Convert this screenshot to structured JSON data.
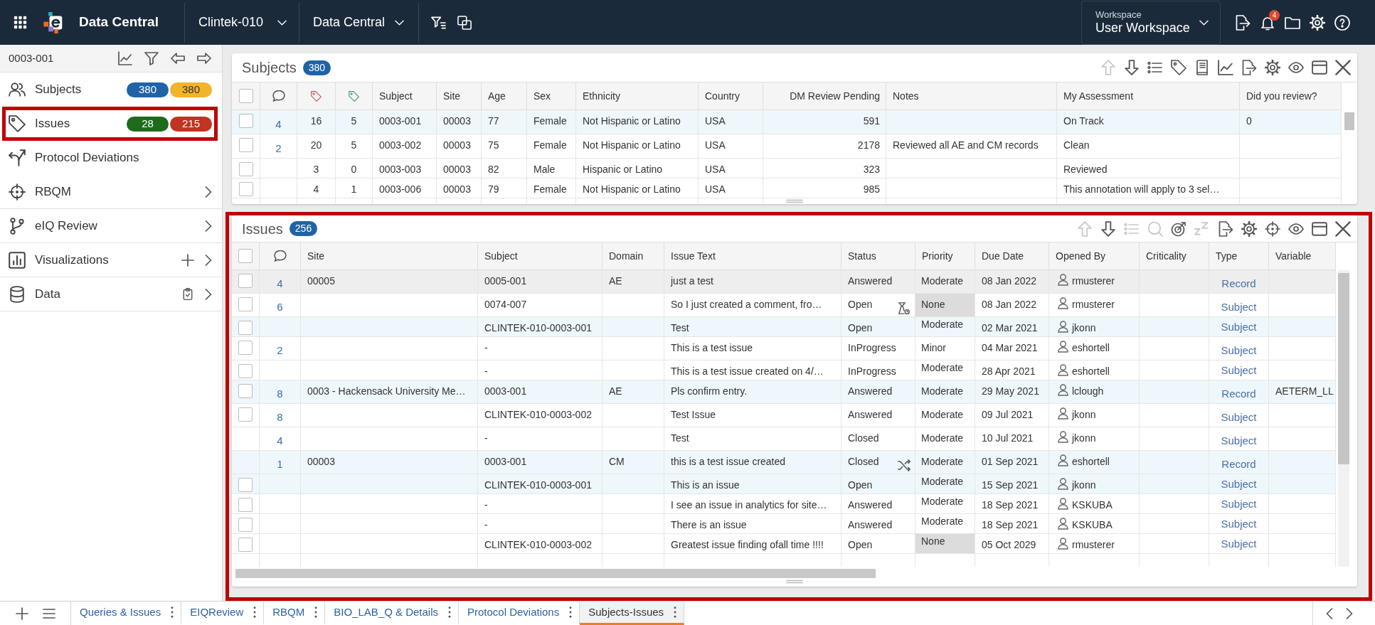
{
  "top_bar": {
    "app_title": "Data Central",
    "study_selector": "Clintek-010",
    "module_selector": "Data Central",
    "workspace": {
      "label": "Workspace",
      "value": "User Workspace"
    },
    "notification_count": "4"
  },
  "sidebar": {
    "context": "0003-001",
    "items": [
      {
        "label": "Subjects",
        "badges": [
          {
            "text": "380",
            "color": "#1f63a6"
          },
          {
            "text": "380",
            "color": "#f2b42b"
          }
        ],
        "submenu": false,
        "action": false,
        "highlighted": false
      },
      {
        "label": "Issues",
        "badges": [
          {
            "text": "28",
            "color": "#1e6b1c"
          },
          {
            "text": "215",
            "color": "#c23321"
          }
        ],
        "submenu": false,
        "action": false,
        "highlighted": true
      },
      {
        "label": "Protocol Deviations",
        "submenu": false,
        "action": false,
        "highlighted": false
      },
      {
        "label": "RBQM",
        "submenu": true,
        "action": false,
        "highlighted": false
      },
      {
        "label": "eIQ Review",
        "submenu": true,
        "action": false,
        "highlighted": false
      },
      {
        "label": "Visualizations",
        "submenu": true,
        "action": true,
        "highlighted": false
      },
      {
        "label": "Data",
        "submenu": true,
        "action": true,
        "highlighted": false
      }
    ]
  },
  "subjects_panel": {
    "title": "Subjects",
    "count": "380",
    "highlighted": false,
    "toolbar": [
      {
        "disabled": true
      },
      {
        "disabled": false
      },
      {
        "disabled": false
      },
      {
        "disabled": false
      },
      {
        "disabled": false
      },
      {
        "disabled": false
      },
      {
        "disabled": false
      },
      {
        "disabled": false
      },
      {
        "disabled": false
      },
      {
        "disabled": false
      },
      {
        "disabled": false
      }
    ],
    "select_all_checked": false,
    "columns": [
      "Subject",
      "Site",
      "Age",
      "Sex",
      "Ethnicity",
      "Country",
      "DM Review Pending",
      "Notes",
      "My Assessment",
      "Did you review?"
    ],
    "rows": [
      {
        "selected": true,
        "checked": false,
        "comments": "4",
        "tags": [
          "16",
          "5"
        ],
        "subject": "0003-001",
        "site": "00003",
        "age": "77",
        "sex": "Female",
        "ethnicity": "Not Hispanic or Latino",
        "country": "USA",
        "dm_review_pending": "591",
        "my_assessment": "On Track",
        "did_you_review": "0"
      },
      {
        "selected": false,
        "checked": false,
        "comments": "2",
        "tags": [
          "20",
          "5"
        ],
        "subject": "0003-002",
        "site": "00003",
        "age": "75",
        "sex": "Female",
        "ethnicity": "Not Hispanic or Latino",
        "country": "USA",
        "dm_review_pending": "2178",
        "notes": "Reviewed all AE and CM records",
        "my_assessment": "Clean"
      },
      {
        "selected": false,
        "checked": false,
        "tags": [
          "3",
          "0"
        ],
        "subject": "0003-003",
        "site": "00003",
        "age": "82",
        "sex": "Male",
        "ethnicity": "Hispanic or Latino",
        "country": "USA",
        "dm_review_pending": "323",
        "my_assessment": "Reviewed"
      },
      {
        "selected": false,
        "checked": false,
        "tags": [
          "4",
          "1"
        ],
        "subject": "0003-006",
        "site": "00003",
        "age": "79",
        "sex": "Female",
        "ethnicity": "Not Hispanic or Latino",
        "country": "USA",
        "dm_review_pending": "985",
        "my_assessment": "This annotation will apply to 3 sel…"
      }
    ]
  },
  "issues_panel": {
    "title": "Issues",
    "count": "256",
    "highlighted": true,
    "toolbar": [
      {
        "disabled": true
      },
      {
        "disabled": false
      },
      {
        "disabled": true
      },
      {
        "disabled": true
      },
      {
        "disabled": false
      },
      {
        "disabled": true
      },
      {
        "disabled": false
      },
      {
        "disabled": false
      },
      {
        "disabled": false
      },
      {
        "disabled": false
      },
      {
        "disabled": false
      },
      {
        "disabled": false
      }
    ],
    "select_all_checked": false,
    "columns": [
      "Site",
      "Subject",
      "Domain",
      "Issue Text",
      "Status",
      "Priority",
      "Due Date",
      "Opened By",
      "Criticality",
      "Type",
      "Variable"
    ],
    "rows": [
      {
        "selected": false,
        "hovered": true,
        "checkable": true,
        "checked": false,
        "comments": "4",
        "site": "00005",
        "subject": "0005-001",
        "domain": "AE",
        "issue_text": "just a test",
        "status": "Answered",
        "priority": "Moderate",
        "priority_greyed": false,
        "due_date": "08 Jan 2022",
        "opened_by": "rmusterer",
        "type": "Record"
      },
      {
        "selected": false,
        "hovered": false,
        "checkable": true,
        "checked": false,
        "comments": "6",
        "subject": "0074-007",
        "issue_text": "So I just created a comment, fro…",
        "status": "Open",
        "status_marker": {
          "kind": "timer"
        },
        "priority": "None",
        "priority_greyed": true,
        "due_date": "08 Jan 2022",
        "opened_by": "rmusterer",
        "type": "Subject"
      },
      {
        "selected": true,
        "hovered": false,
        "checkable": true,
        "checked": false,
        "subject": "CLINTEK-010-0003-001",
        "issue_text": "Test",
        "status": "Open",
        "priority": "Moderate",
        "priority_greyed": false,
        "due_date": "02 Mar 2021",
        "opened_by": "jkonn",
        "type": "Subject"
      },
      {
        "selected": false,
        "hovered": false,
        "checkable": true,
        "checked": false,
        "comments": "2",
        "subject": "-",
        "issue_text": "This is a test issue",
        "status": "InProgress",
        "priority": "Minor",
        "priority_greyed": false,
        "due_date": "04 Mar 2021",
        "opened_by": "eshortell",
        "type": "Subject"
      },
      {
        "selected": false,
        "hovered": false,
        "checkable": true,
        "checked": false,
        "subject": "-",
        "issue_text": "This is a test issue created on 4/…",
        "status": "InProgress",
        "priority": "Moderate",
        "priority_greyed": false,
        "due_date": "28 Apr 2021",
        "opened_by": "eshortell",
        "type": "Subject"
      },
      {
        "selected": true,
        "hovered": false,
        "checkable": true,
        "checked": false,
        "comments": "8",
        "site": "0003 - Hackensack University Me…",
        "subject": "0003-001",
        "domain": "AE",
        "issue_text": "Pls confirm entry.",
        "status": "Answered",
        "priority": "Moderate",
        "priority_greyed": false,
        "due_date": "29 May 2021",
        "opened_by": "lclough",
        "type": "Record",
        "variable": "AETERM_LL"
      },
      {
        "selected": false,
        "hovered": false,
        "checkable": true,
        "checked": false,
        "comments": "8",
        "subject": "CLINTEK-010-0003-002",
        "issue_text": "Test Issue",
        "status": "Answered",
        "priority": "Moderate",
        "priority_greyed": false,
        "due_date": "09 Jul 2021",
        "opened_by": "jkonn",
        "type": "Subject"
      },
      {
        "selected": false,
        "hovered": false,
        "checkable": false,
        "comments": "4",
        "subject": "-",
        "issue_text": "Test",
        "status": "Closed",
        "priority": "Moderate",
        "priority_greyed": false,
        "due_date": "10 Jul 2021",
        "opened_by": "jkonn",
        "type": "Subject"
      },
      {
        "selected": true,
        "hovered": false,
        "checkable": false,
        "comments": "1",
        "site": "00003",
        "subject": "0003-001",
        "domain": "CM",
        "issue_text": "this is a test issue created",
        "status": "Closed",
        "status_marker": {
          "kind": "shuffle"
        },
        "priority": "Moderate",
        "priority_greyed": false,
        "due_date": "01 Sep 2021",
        "opened_by": "eshortell",
        "type": "Record"
      },
      {
        "selected": true,
        "hovered": false,
        "checkable": true,
        "checked": false,
        "subject": "CLINTEK-010-0003-001",
        "issue_text": "This is an issue",
        "status": "Open",
        "priority": "Moderate",
        "priority_greyed": false,
        "due_date": "15 Sep 2021",
        "opened_by": "jkonn",
        "type": "Subject"
      },
      {
        "selected": false,
        "hovered": false,
        "checkable": true,
        "checked": false,
        "subject": "-",
        "issue_text": "I see an issue in analytics for site…",
        "status": "Answered",
        "priority": "Moderate",
        "priority_greyed": false,
        "due_date": "18 Sep 2021",
        "opened_by": "KSKUBA",
        "type": "Subject"
      },
      {
        "selected": false,
        "hovered": false,
        "checkable": true,
        "checked": false,
        "subject": "-",
        "issue_text": "There is an issue",
        "status": "Answered",
        "priority": "Moderate",
        "priority_greyed": false,
        "due_date": "18 Sep 2021",
        "opened_by": "KSKUBA",
        "type": "Subject"
      },
      {
        "selected": false,
        "hovered": false,
        "checkable": true,
        "checked": false,
        "subject": "CLINTEK-010-0003-002",
        "issue_text": "Greatest issue finding ofall time !!!!",
        "status": "Open",
        "priority": "None",
        "priority_greyed": true,
        "due_date": "05 Oct 2029",
        "opened_by": "rmusterer",
        "type": "Subject"
      }
    ]
  },
  "bottom_tabs": [
    {
      "label": "Queries & Issues",
      "selected": false
    },
    {
      "label": "EIQReview",
      "selected": false
    },
    {
      "label": "RBQM",
      "selected": false
    },
    {
      "label": "BIO_LAB_Q & Details",
      "selected": false
    },
    {
      "label": "Protocol Deviations",
      "selected": false
    },
    {
      "label": "Subjects-Issues",
      "selected": true
    }
  ]
}
